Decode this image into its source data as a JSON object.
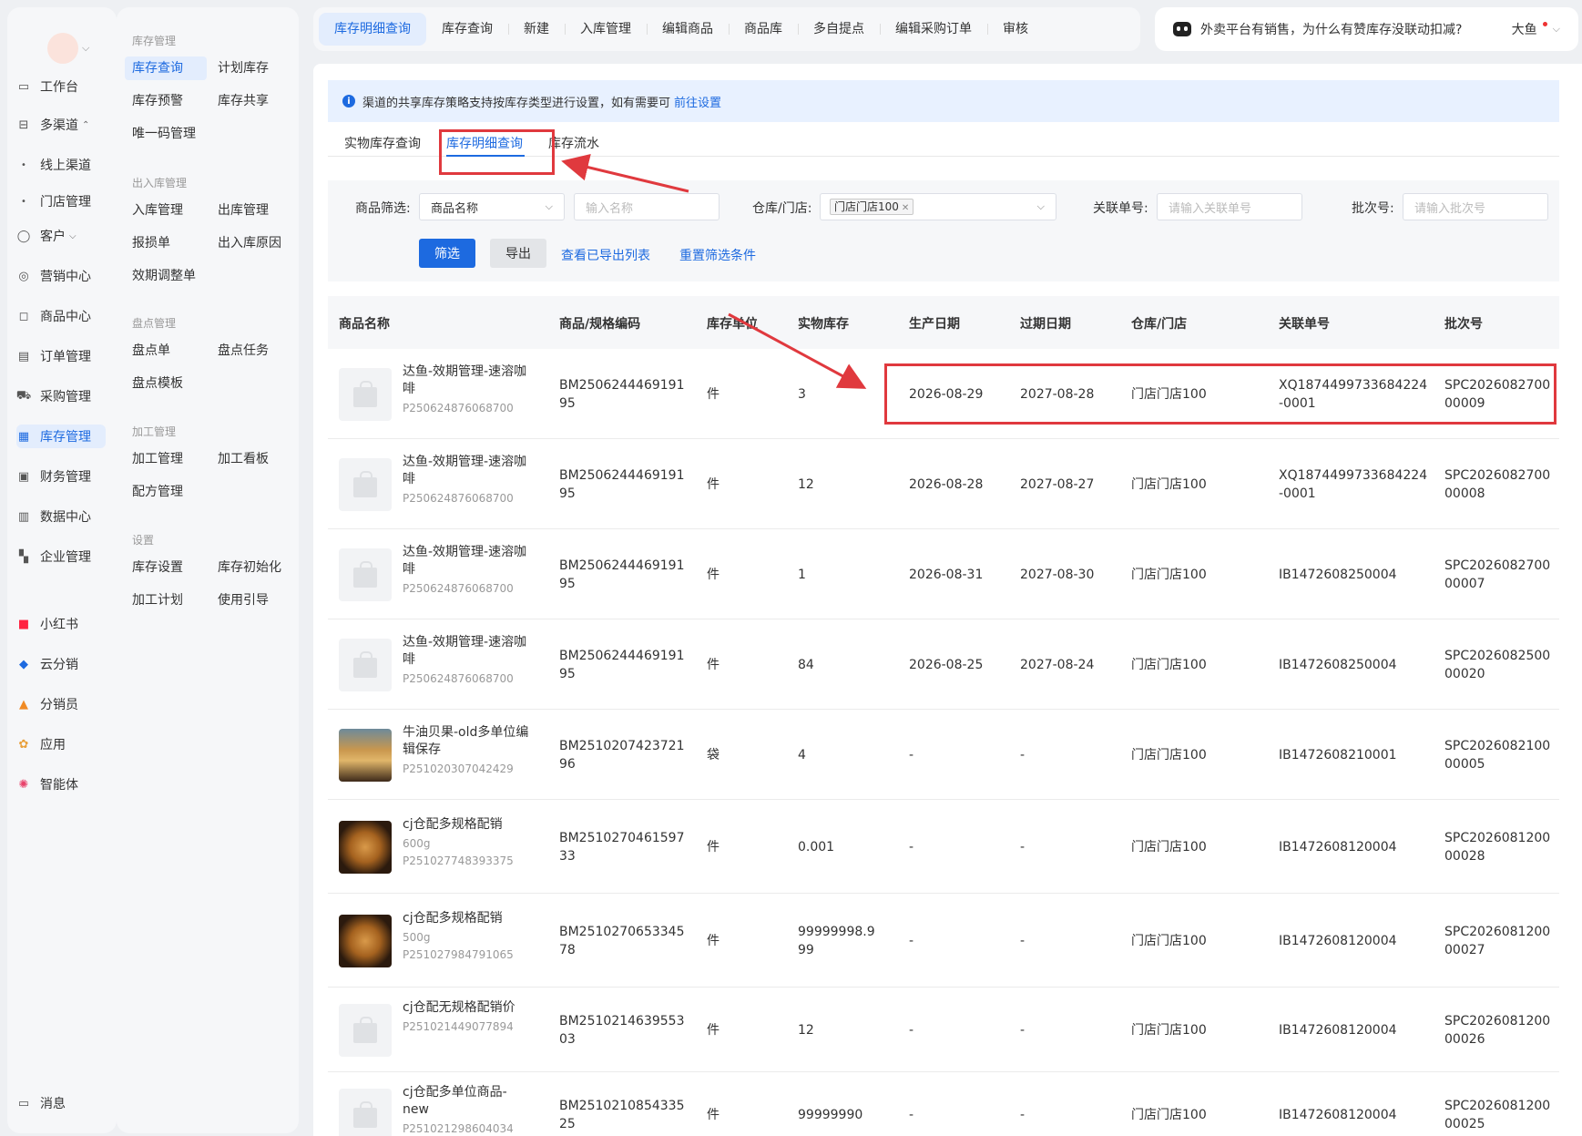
{
  "nav_primary": {
    "items": [
      {
        "label": "工作台",
        "icon": "desk-icon"
      },
      {
        "label": "多渠道",
        "icon": "store-icon",
        "expanded": true
      },
      {
        "label": "线上渠道",
        "icon": "dot-icon"
      },
      {
        "label": "门店管理",
        "icon": "dot-icon"
      },
      {
        "label": "客户",
        "icon": "user-icon"
      },
      {
        "label": "营销中心",
        "icon": "marketing-icon"
      },
      {
        "label": "商品中心",
        "icon": "bag-icon"
      },
      {
        "label": "订单管理",
        "icon": "order-icon"
      },
      {
        "label": "采购管理",
        "icon": "cart-icon"
      },
      {
        "label": "库存管理",
        "icon": "warehouse-icon",
        "active": true
      },
      {
        "label": "财务管理",
        "icon": "finance-icon"
      },
      {
        "label": "数据中心",
        "icon": "chart-icon"
      },
      {
        "label": "企业管理",
        "icon": "building-icon"
      },
      {
        "label": "小红书",
        "icon": "xiaohongshu-icon"
      },
      {
        "label": "云分销",
        "icon": "cloud-distribution-icon"
      },
      {
        "label": "分销员",
        "icon": "distributor-icon"
      },
      {
        "label": "应用",
        "icon": "apps-icon"
      },
      {
        "label": "智能体",
        "icon": "agent-icon"
      }
    ],
    "messages_label": "消息"
  },
  "nav_secondary": {
    "groups": [
      {
        "title": "库存管理",
        "items": [
          "库存查询",
          "计划库存",
          "库存预警",
          "库存共享",
          "唯一码管理"
        ]
      },
      {
        "title": "出入库管理",
        "items": [
          "入库管理",
          "出库管理",
          "报损单",
          "出入库原因",
          "效期调整单"
        ]
      },
      {
        "title": "盘点管理",
        "items": [
          "盘点单",
          "盘点任务",
          "盘点模板"
        ]
      },
      {
        "title": "加工管理",
        "items": [
          "加工管理",
          "加工看板",
          "配方管理"
        ]
      },
      {
        "title": "设置",
        "items": [
          "库存设置",
          "库存初始化",
          "加工计划",
          "使用引导"
        ]
      }
    ],
    "active_item": "库存查询"
  },
  "top_tabs": [
    "库存明细查询",
    "库存查询",
    "新建",
    "入库管理",
    "编辑商品",
    "商品库",
    "多自提点",
    "编辑采购订单",
    "审核"
  ],
  "assistant": {
    "question": "外卖平台有销售，为什么有赞库存没联动扣减?",
    "user_name": "大鱼"
  },
  "notice": {
    "text": "渠道的共享库存策略支持按库存类型进行设置，如有需要可",
    "link": "前往设置"
  },
  "sub_tabs": [
    "实物库存查询",
    "库存明细查询",
    "库存流水"
  ],
  "filters": {
    "product_filter_label": "商品筛选:",
    "product_filter_value": "商品名称",
    "name_placeholder": "输入名称",
    "warehouse_label": "仓库/门店:",
    "warehouse_chip": "门店门店100",
    "related_label": "关联单号:",
    "related_placeholder": "请输入关联单号",
    "batch_label": "批次号:",
    "batch_placeholder": "请输入批次号",
    "filter_button": "筛选",
    "export_button": "导出",
    "view_exports_link": "查看已导出列表",
    "reset_link": "重置筛选条件"
  },
  "table": {
    "columns": [
      "商品名称",
      "商品/规格编码",
      "库存单位",
      "实物库存",
      "生产日期",
      "过期日期",
      "仓库/门店",
      "关联单号",
      "批次号"
    ],
    "rows": [
      {
        "name": "达鱼-效期管理-速溶咖啡",
        "spec": "",
        "code": "P250624876068700",
        "sku": "BM250624446919195",
        "unit": "件",
        "stock": "3",
        "prod": "2026-08-29",
        "exp": "2027-08-28",
        "store": "门店门店100",
        "ref": "XQ1874499733684224-0001",
        "batch": "SPC202608270000009",
        "img": "placeholder"
      },
      {
        "name": "达鱼-效期管理-速溶咖啡",
        "spec": "",
        "code": "P250624876068700",
        "sku": "BM250624446919195",
        "unit": "件",
        "stock": "12",
        "prod": "2026-08-28",
        "exp": "2027-08-27",
        "store": "门店门店100",
        "ref": "XQ1874499733684224-0001",
        "batch": "SPC202608270000008",
        "img": "placeholder"
      },
      {
        "name": "达鱼-效期管理-速溶咖啡",
        "spec": "",
        "code": "P250624876068700",
        "sku": "BM250624446919195",
        "unit": "件",
        "stock": "1",
        "prod": "2026-08-31",
        "exp": "2027-08-30",
        "store": "门店门店100",
        "ref": "IB1472608250004",
        "batch": "SPC202608270000007",
        "img": "placeholder"
      },
      {
        "name": "达鱼-效期管理-速溶咖啡",
        "spec": "",
        "code": "P250624876068700",
        "sku": "BM250624446919195",
        "unit": "件",
        "stock": "84",
        "prod": "2026-08-25",
        "exp": "2027-08-24",
        "store": "门店门店100",
        "ref": "IB1472608250004",
        "batch": "SPC202608250000020",
        "img": "placeholder"
      },
      {
        "name": "牛油贝果-old多单位编辑保存",
        "spec": "",
        "code": "P251020307042429",
        "sku": "BM251020742372196",
        "unit": "袋",
        "stock": "4",
        "prod": "-",
        "exp": "-",
        "store": "门店门店100",
        "ref": "IB1472608210001",
        "batch": "SPC202608210000005",
        "img": "bagel"
      },
      {
        "name": "cj仓配多规格配销",
        "spec": "600g",
        "code": "P251027748393375",
        "sku": "BM251027046159733",
        "unit": "件",
        "stock": "0.001",
        "prod": "-",
        "exp": "-",
        "store": "门店门店100",
        "ref": "IB1472608120004",
        "batch": "SPC202608120000028",
        "img": "bread"
      },
      {
        "name": "cj仓配多规格配销",
        "spec": "500g",
        "code": "P251027984791065",
        "sku": "BM251027065334578",
        "unit": "件",
        "stock": "99999998.999",
        "prod": "-",
        "exp": "-",
        "store": "门店门店100",
        "ref": "IB1472608120004",
        "batch": "SPC202608120000027",
        "img": "bread"
      },
      {
        "name": "cj仓配无规格配销价",
        "spec": "",
        "code": "P251021449077894",
        "sku": "BM251021463955303",
        "unit": "件",
        "stock": "12",
        "prod": "-",
        "exp": "-",
        "store": "门店门店100",
        "ref": "IB1472608120004",
        "batch": "SPC202608120000026",
        "img": "placeholder"
      },
      {
        "name": "cj仓配多单位商品-new",
        "spec": "",
        "code": "P251021298604034",
        "sku": "BM251021085433525",
        "unit": "件",
        "stock": "99999990",
        "prod": "-",
        "exp": "-",
        "store": "门店门店100",
        "ref": "IB1472608120004",
        "batch": "SPC202608120000025",
        "img": "placeholder"
      }
    ]
  },
  "colors": {
    "accent": "#1d6ae0",
    "annotation": "#e0393e",
    "panel": "#f6f7f9"
  }
}
